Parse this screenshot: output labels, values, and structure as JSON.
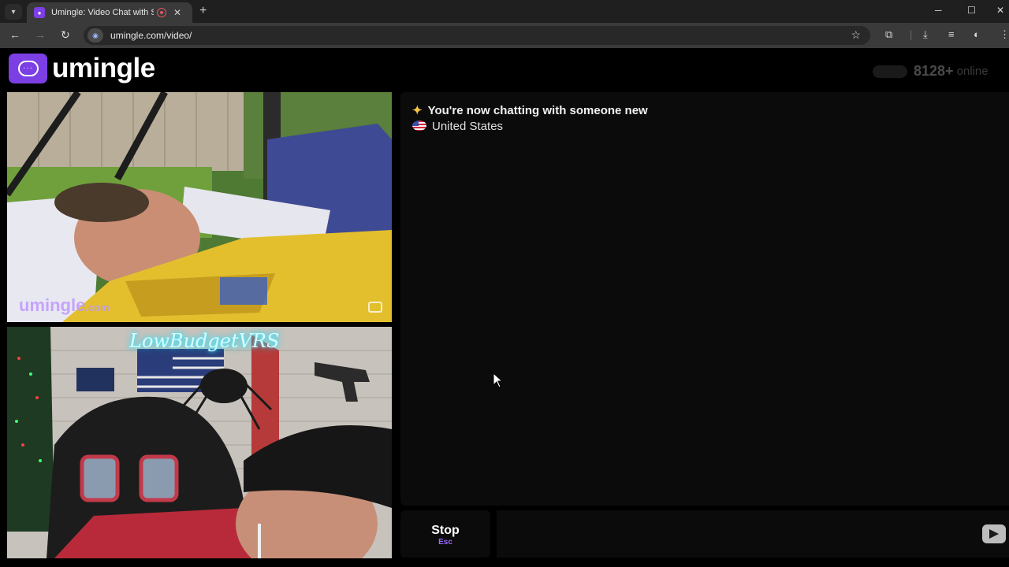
{
  "browser": {
    "tab_title": "Umingle: Video Chat with Strangers",
    "url": "umingle.com/video/"
  },
  "site": {
    "logo_text": "umingle",
    "online_count": "8128+",
    "online_label": "online",
    "accent_color": "#7b3fe4"
  },
  "videos": {
    "stranger_watermark": "umingle",
    "stranger_watermark_suffix": ".com",
    "self_sign": "LowBudgetVRS"
  },
  "chat": {
    "status_message": "You're now chatting with someone new",
    "country": "United States"
  },
  "controls": {
    "stop_label": "Stop",
    "stop_shortcut": "Esc",
    "input_placeholder": ""
  },
  "icons": [
    "tab-menu-icon",
    "recording-icon",
    "close-icon",
    "new-tab-icon",
    "back-icon",
    "forward-icon",
    "reload-icon",
    "site-info-icon",
    "star-icon",
    "extensions-icon",
    "download-icon",
    "media-icon",
    "profile-icon",
    "menu-icon",
    "chat-bubble-icon",
    "sparkle-icon",
    "flag-icon",
    "report-icon",
    "send-icon",
    "mouse-cursor-icon"
  ]
}
